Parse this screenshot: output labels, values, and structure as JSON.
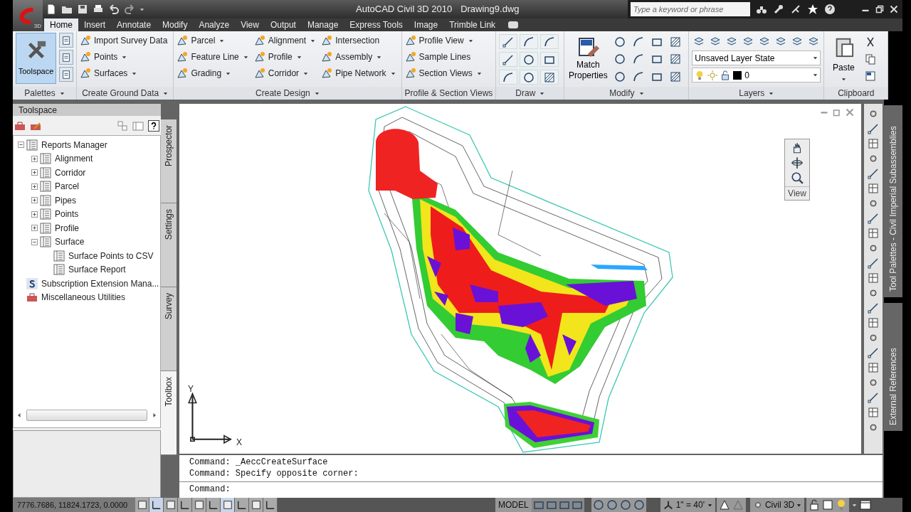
{
  "app": {
    "badge": "3D"
  },
  "window": {
    "title": "AutoCAD Civil 3D 2010",
    "document": "Drawing9.dwg"
  },
  "search": {
    "placeholder": "Type a keyword or phrase"
  },
  "tabs": [
    {
      "label": "Home",
      "selected": true
    },
    {
      "label": "Insert",
      "selected": false
    },
    {
      "label": "Annotate",
      "selected": false
    },
    {
      "label": "Modify",
      "selected": false
    },
    {
      "label": "Analyze",
      "selected": false
    },
    {
      "label": "View",
      "selected": false
    },
    {
      "label": "Output",
      "selected": false
    },
    {
      "label": "Manage",
      "selected": false
    },
    {
      "label": "Express Tools",
      "selected": false
    },
    {
      "label": "Image",
      "selected": false
    },
    {
      "label": "Trimble Link",
      "selected": false
    }
  ],
  "ribbon": {
    "panels": [
      {
        "kind": "palettes",
        "title": "Palettes",
        "menu": true,
        "button": {
          "label": "Toolspace",
          "selected": true
        }
      },
      {
        "kind": "list",
        "title": "Create Ground Data",
        "menu": true,
        "columns": [
          [
            {
              "label": "Import Survey Data",
              "dropdown": false
            },
            {
              "label": "Points",
              "dropdown": true
            },
            {
              "label": "Surfaces",
              "dropdown": true
            }
          ]
        ]
      },
      {
        "kind": "list",
        "title": "Create Design",
        "menu": true,
        "columns": [
          [
            {
              "label": "Parcel",
              "dropdown": true
            },
            {
              "label": "Feature Line",
              "dropdown": true
            },
            {
              "label": "Grading",
              "dropdown": true
            }
          ],
          [
            {
              "label": "Alignment",
              "dropdown": true
            },
            {
              "label": "Profile",
              "dropdown": true
            },
            {
              "label": "Corridor",
              "dropdown": true
            }
          ],
          [
            {
              "label": "Intersection",
              "dropdown": false
            },
            {
              "label": "Assembly",
              "dropdown": true
            },
            {
              "label": "Pipe Network",
              "dropdown": true
            }
          ]
        ]
      },
      {
        "kind": "list",
        "title": "Profile & Section Views",
        "menu": false,
        "columns": [
          [
            {
              "label": "Profile View",
              "dropdown": true
            },
            {
              "label": "Sample Lines",
              "dropdown": false
            },
            {
              "label": "Section Views",
              "dropdown": true
            }
          ]
        ]
      },
      {
        "kind": "draw",
        "title": "Draw",
        "menu": true
      },
      {
        "kind": "modify",
        "title": "Modify",
        "menu": true,
        "button": "Match Properties"
      },
      {
        "kind": "layers",
        "title": "Layers",
        "menu": true,
        "layer_state": "Unsaved Layer State",
        "current_layer": "0"
      },
      {
        "kind": "clipboard",
        "title": "Clipboard",
        "menu": false,
        "button": "Paste"
      }
    ]
  },
  "toolspace": {
    "title": "Toolspace",
    "tree": [
      {
        "label": "Reports Manager",
        "kind": "report",
        "expanded": true,
        "children": [
          {
            "label": "Alignment",
            "kind": "report",
            "expanded": false
          },
          {
            "label": "Corridor",
            "kind": "report",
            "expanded": false
          },
          {
            "label": "Parcel",
            "kind": "report",
            "expanded": false
          },
          {
            "label": "Pipes",
            "kind": "report",
            "expanded": false
          },
          {
            "label": "Points",
            "kind": "report",
            "expanded": false
          },
          {
            "label": "Profile",
            "kind": "report",
            "expanded": false
          },
          {
            "label": "Surface",
            "kind": "report",
            "expanded": true,
            "children": [
              {
                "label": "Surface Points to CSV",
                "kind": "report"
              },
              {
                "label": "Surface Report",
                "kind": "report"
              }
            ]
          }
        ]
      },
      {
        "label": "Subscription Extension Mana...",
        "kind": "subscription"
      },
      {
        "label": "Miscellaneous Utilities",
        "kind": "toolbox"
      }
    ],
    "tabs": [
      {
        "label": "Prospector",
        "selected": false
      },
      {
        "label": "Settings",
        "selected": false
      },
      {
        "label": "Survey",
        "selected": false
      },
      {
        "label": "Toolbox",
        "selected": true
      }
    ]
  },
  "viewport": {
    "nav_label": "View",
    "ucs": {
      "y": "Y",
      "x": "X"
    }
  },
  "side_palettes": [
    "Tool Palettes - Civil Imperial Subassemblies",
    "External References"
  ],
  "command": {
    "history": [
      "Command: _AeccCreateSurface",
      "Command: Specify opposite corner:"
    ],
    "prompt": "Command:"
  },
  "status_bar": {
    "coordinates": "7776.7686, 11824.1723, 0.0000",
    "toggles": [
      {
        "on": false
      },
      {
        "on": true
      },
      {
        "on": false
      },
      {
        "on": false
      },
      {
        "on": false
      },
      {
        "on": false
      },
      {
        "on": true
      },
      {
        "on": false
      },
      {
        "on": false
      },
      {
        "on": false
      }
    ],
    "space": "MODEL",
    "annotation_scale": "1\" = 40'",
    "workspace": "Civil 3D"
  }
}
